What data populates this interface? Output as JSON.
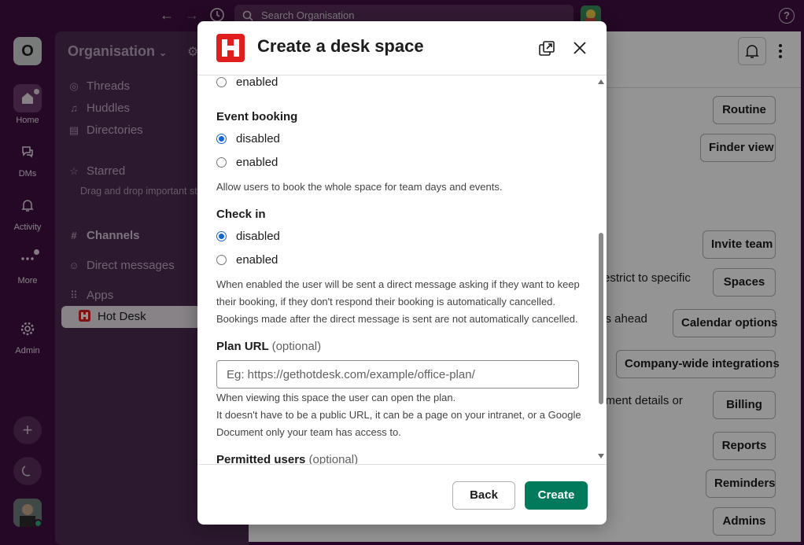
{
  "topbar": {
    "back_icon": "arrow-left-icon",
    "forward_icon": "arrow-right-icon",
    "history_icon": "clock-icon",
    "search_placeholder": "Search Organisation",
    "help_label": "?"
  },
  "rail": {
    "workspace_initial": "O",
    "items": [
      {
        "label": "Home",
        "icon": "home-icon"
      },
      {
        "label": "DMs",
        "icon": "chat-bubbles-icon"
      },
      {
        "label": "Activity",
        "icon": "bell-icon"
      },
      {
        "label": "More",
        "icon": "ellipsis-icon"
      },
      {
        "label": "Admin",
        "icon": "gear-icon"
      }
    ],
    "add_label": "+",
    "theme_icon": "moon-icon"
  },
  "sidebar": {
    "org_name": "Organisation",
    "items": {
      "threads": "Threads",
      "huddles": "Huddles",
      "directories": "Directories",
      "starred": "Starred",
      "starred_hint": "Drag and drop important stuff here",
      "channels": "Channels",
      "direct_messages": "Direct messages",
      "apps": "Apps",
      "hot_desk": "Hot Desk"
    }
  },
  "main": {
    "buttons": {
      "routine": "Routine",
      "finder_view": "Finder view",
      "invite_team": "Invite team",
      "spaces": "Spaces",
      "calendar_options": "Calendar options",
      "company_integrations": "Company-wide integrations",
      "billing": "Billing",
      "reports": "Reports",
      "reminders": "Reminders",
      "admins": "Admins"
    },
    "snippets": {
      "s1": "restrict to specific",
      "s2": "ys ahead",
      "s3": "yment details or"
    }
  },
  "modal": {
    "title": "Create a desk space",
    "prev_enabled_label": "enabled",
    "event_booking": {
      "heading": "Event booking",
      "option_disabled": "disabled",
      "option_enabled": "enabled",
      "selected": "disabled",
      "help": "Allow users to book the whole space for team days and events."
    },
    "check_in": {
      "heading": "Check in",
      "option_disabled": "disabled",
      "option_enabled": "enabled",
      "selected": "disabled",
      "help_line1": "When enabled the user will be sent a direct message asking if they want to keep",
      "help_line2": "their booking, if they don't respond their booking is automatically cancelled.",
      "help_line3": "Bookings made after the direct message is sent are not automatically cancelled."
    },
    "plan_url": {
      "label": "Plan URL",
      "optional": "(optional)",
      "value": "",
      "placeholder": "Eg: https://gethotdesk.com/example/office-plan/",
      "help_line1": "When viewing this space the user can open the plan.",
      "help_line2": "It doesn't have to be a public URL, it can be a page on your intranet, or a Google",
      "help_line3": "Document only your team has access to."
    },
    "permitted_users": {
      "label": "Permitted users",
      "optional": "(optional)"
    },
    "footer": {
      "back": "Back",
      "create": "Create"
    },
    "accent": "#007a5a",
    "radio_color": "#1264d6",
    "brand_color": "#e01e1e"
  }
}
